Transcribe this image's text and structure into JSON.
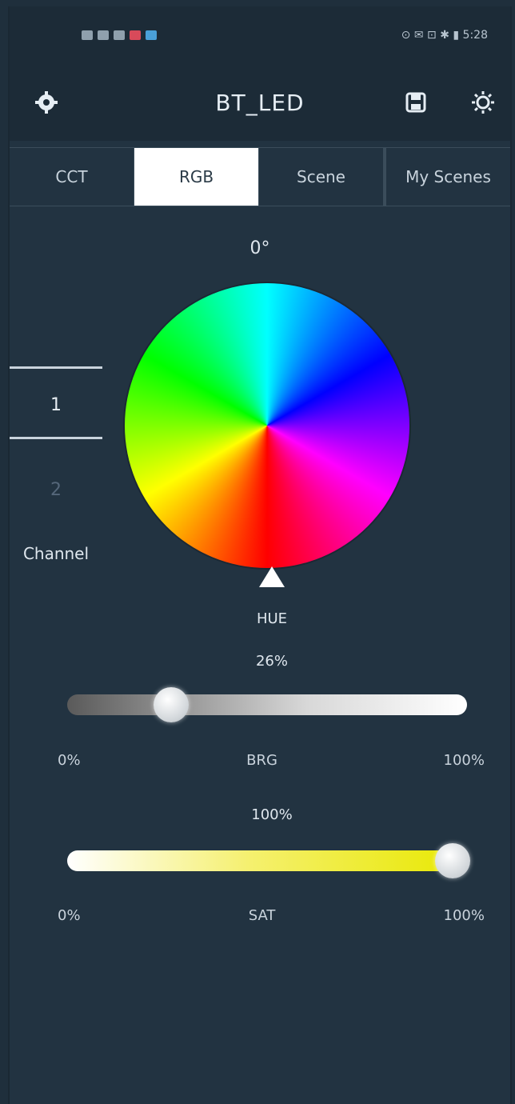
{
  "status_bar": {
    "left_icons": [
      "signal-icon",
      "wifi-icon",
      "notification-icon",
      "app-icon-red",
      "app-icon-blue"
    ],
    "right_text": "⊙ ✉ ⊡ ✱ ▮ 5:28"
  },
  "app": {
    "title": "BT_LED"
  },
  "tabs": [
    {
      "label": "CCT",
      "active": false
    },
    {
      "label": "RGB",
      "active": true
    },
    {
      "label": "Scene",
      "active": false
    },
    {
      "label": "My Scenes",
      "active": false
    }
  ],
  "hue": {
    "readout": "0°",
    "value_degrees": 0,
    "label": "HUE"
  },
  "channel": {
    "selected": "1",
    "next": "2",
    "label": "Channel"
  },
  "brightness": {
    "percent_text": "26%",
    "value": 0.26,
    "min_label": "0%",
    "name": "BRG",
    "max_label": "100%"
  },
  "saturation": {
    "percent_text": "100%",
    "value": 1.0,
    "min_label": "0%",
    "name": "SAT",
    "max_label": "100%"
  }
}
